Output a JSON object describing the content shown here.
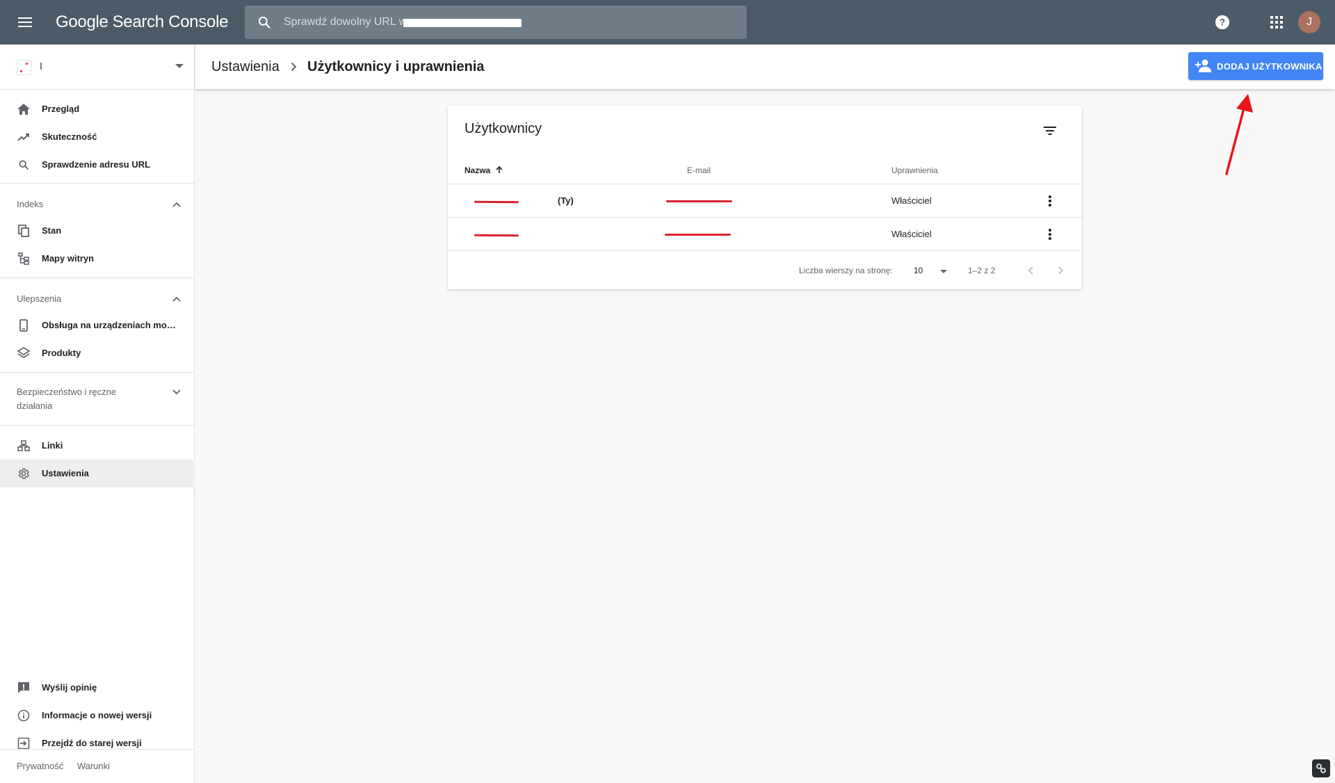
{
  "topbar": {
    "logo_google": "Google",
    "logo_product": "Search Console",
    "search_placeholder": "Sprawdź dowolny URL w „",
    "avatar_initial": "J",
    "bar_color": "#4b5c68"
  },
  "sidebar": {
    "items_top": [
      {
        "label": "Przegląd",
        "icon": "home-icon"
      },
      {
        "label": "Skuteczność",
        "icon": "trending-up-icon"
      },
      {
        "label": "Sprawdzenie adresu URL",
        "icon": "search-icon"
      }
    ],
    "section_index": {
      "title": "Indeks",
      "items": [
        {
          "label": "Stan",
          "icon": "copy-pages-icon"
        },
        {
          "label": "Mapy witryn",
          "icon": "sitemap-icon"
        }
      ]
    },
    "section_enhancements": {
      "title": "Ulepszenia",
      "items": [
        {
          "label": "Obsługa na urządzeniach mobil…",
          "icon": "smartphone-icon"
        },
        {
          "label": "Produkty",
          "icon": "layers-icon"
        }
      ]
    },
    "section_security": {
      "title_line1": "Bezpieczeństwo i ręczne",
      "title_line2": "działania"
    },
    "items_bottom": [
      {
        "label": "Linki",
        "icon": "links-icon"
      },
      {
        "label": "Ustawienia",
        "icon": "gear-icon",
        "active": true
      }
    ],
    "items_footer": [
      {
        "label": "Wyślij opinię",
        "icon": "feedback-icon"
      },
      {
        "label": "Informacje o nowej wersji",
        "icon": "info-icon"
      },
      {
        "label": "Przejdź do starej wersji",
        "icon": "exit-icon"
      }
    ],
    "links": {
      "privacy": "Prywatność",
      "terms": "Warunki"
    }
  },
  "header": {
    "breadcrumb_parent": "Ustawienia",
    "breadcrumb_current": "Użytkownicy i uprawnienia",
    "add_user_label": "DODAJ UŻYTKOWNIKA",
    "accent_color": "#4285f4"
  },
  "users_card": {
    "title": "Użytkownicy",
    "columns": {
      "name": "Nazwa",
      "email": "E-mail",
      "permission": "Uprawnienia"
    },
    "rows": [
      {
        "name_suffix": "(Ty)",
        "permission": "Właściciel"
      },
      {
        "name_suffix": "",
        "permission": "Właściciel"
      }
    ],
    "pagination": {
      "rows_per_page_label": "Liczba wierszy na stronę:",
      "rows_per_page_value": "10",
      "range": "1–2 z 2"
    }
  },
  "annotation": {
    "arrow_color": "#e8151b"
  }
}
